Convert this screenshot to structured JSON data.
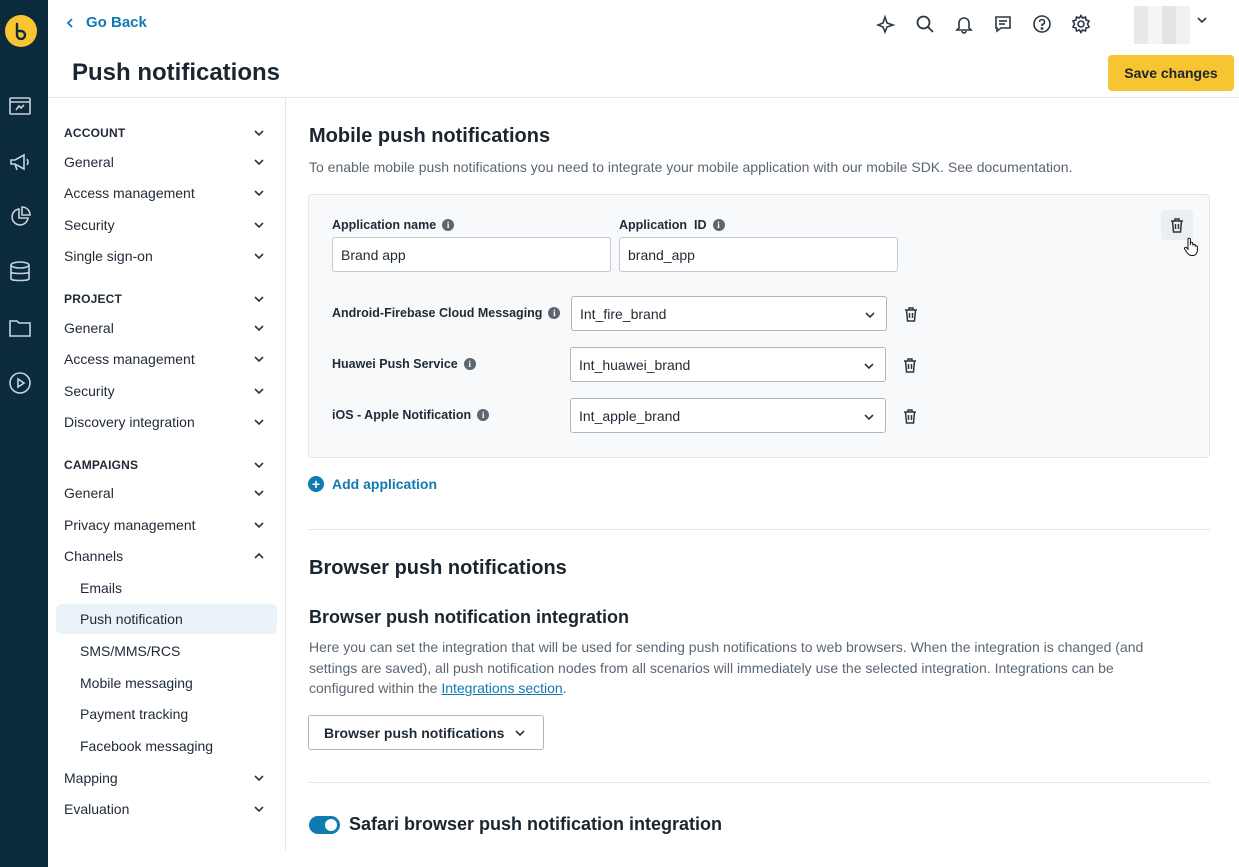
{
  "header": {
    "go_back": "Go Back",
    "title": "Push notifications",
    "save_label": "Save changes",
    "icons": [
      "sparkle-icon",
      "search-icon",
      "bell-icon",
      "chat-icon",
      "help-icon",
      "gear-icon"
    ]
  },
  "rail": {
    "icons": [
      "logo-icon",
      "dashboard-icon",
      "megaphone-icon",
      "pie-chart-icon",
      "database-icon",
      "folder-icon",
      "play-icon"
    ]
  },
  "sidebar": {
    "items": [
      {
        "label": "ACCOUNT",
        "type": "section"
      },
      {
        "label": "General",
        "type": "item"
      },
      {
        "label": "Access management",
        "type": "item"
      },
      {
        "label": "Security",
        "type": "item"
      },
      {
        "label": "Single sign-on",
        "type": "item"
      },
      {
        "label": "PROJECT",
        "type": "section"
      },
      {
        "label": "General",
        "type": "item"
      },
      {
        "label": "Access management",
        "type": "item"
      },
      {
        "label": "Security",
        "type": "item"
      },
      {
        "label": "Discovery integration",
        "type": "item"
      },
      {
        "label": "CAMPAIGNS",
        "type": "section"
      },
      {
        "label": "General",
        "type": "item"
      },
      {
        "label": "Privacy management",
        "type": "item"
      },
      {
        "label": "Channels",
        "type": "item",
        "expanded": true
      },
      {
        "label": "Emails",
        "type": "sub"
      },
      {
        "label": "Push notification",
        "type": "sub",
        "active": true
      },
      {
        "label": "SMS/MMS/RCS",
        "type": "sub"
      },
      {
        "label": "Mobile messaging",
        "type": "sub"
      },
      {
        "label": "Payment tracking",
        "type": "sub"
      },
      {
        "label": "Facebook messaging",
        "type": "sub"
      },
      {
        "label": "Mapping",
        "type": "item"
      },
      {
        "label": "Evaluation",
        "type": "item"
      }
    ]
  },
  "mobile": {
    "title": "Mobile push notifications",
    "description": "To enable mobile push notifications you need to integrate your mobile application with our mobile SDK. See documentation.",
    "app_name_label": "Application name",
    "app_name_value": "Brand app",
    "app_id_label": "Application  ID",
    "app_id_value": "brand_app",
    "integrations": [
      {
        "label": "Android-Firebase Cloud Messaging",
        "value": "Int_fire_brand"
      },
      {
        "label": "Huawei Push Service",
        "value": "Int_huawei_brand"
      },
      {
        "label": "iOS - Apple Notification",
        "value": "Int_apple_brand"
      }
    ],
    "add_application": "Add application"
  },
  "browser": {
    "title": "Browser push notifications",
    "subtitle": "Browser push notification integration",
    "paragraph_before_link": "Here you can set the integration that will be used for sending push notifications to web browsers. When the integration is changed (and settings are saved), all push notification nodes from all scenarios will immediately use the selected integration. Integrations can be configured within the ",
    "link": "Integrations section",
    "paragraph_after_link": ".",
    "dropdown_value": "Browser push notifications"
  },
  "safari": {
    "title": "Safari browser push notification integration",
    "enabled": true
  },
  "colors": {
    "rail_bg": "#0b2a3c",
    "accent": "#0f7bb0",
    "save_button": "#f7c531",
    "active_item_bg": "#e9f3f8"
  }
}
